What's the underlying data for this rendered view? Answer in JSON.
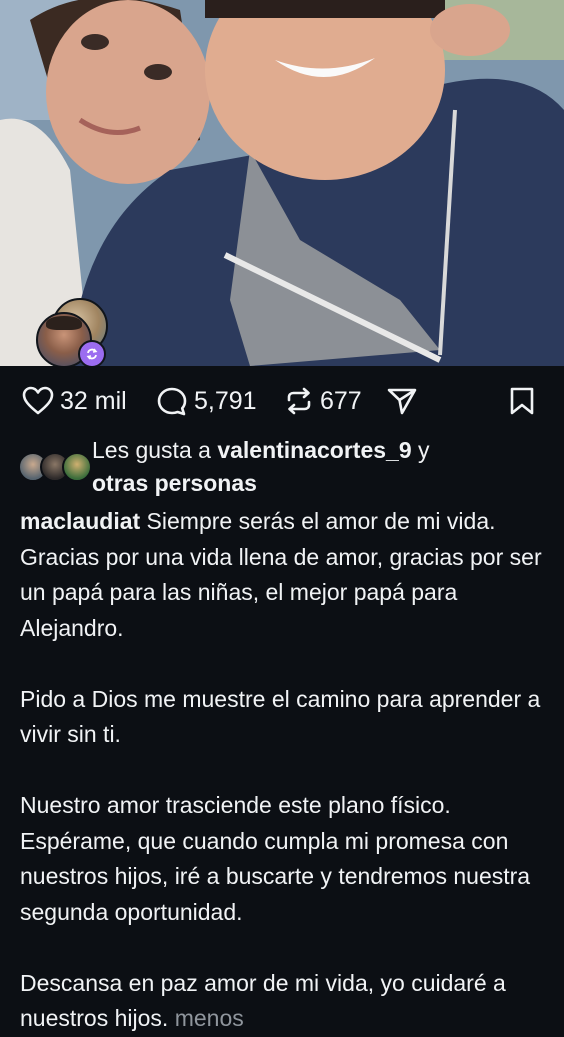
{
  "post": {
    "photo_description_icon": "photo",
    "avatar_badge_icon": "repost-arrows-icon"
  },
  "actions": {
    "likes_count": "32 mil",
    "comments_count": "5,791",
    "reposts_count": "677"
  },
  "likes_line": {
    "prefix": "Les gusta a ",
    "user": "valentinacortes_9",
    "connector": " y",
    "others": "otras personas"
  },
  "caption": {
    "username": "maclaudiat",
    "paragraph_1": " Siempre serás el amor de mi vida. Gracias por una vida llena de amor, gracias por ser un papá para las niñas, el mejor papá para Alejandro.",
    "paragraph_2": "Pido a Dios me muestre el camino para aprender a vivir sin ti.",
    "paragraph_3": "Nuestro amor trasciende este plano físico. Espérame, que cuando cumpla mi promesa con nuestros hijos, iré a buscarte y tendremos nuestra segunda oportunidad.",
    "paragraph_4": "Descansa en paz amor de mi vida, yo cuidaré a nuestros hijos.",
    "less_link": " menos"
  },
  "colors": {
    "background": "#0c0f14",
    "text": "#f1f3f5",
    "muted": "#8f959c",
    "badge": "#9b6cf0"
  }
}
